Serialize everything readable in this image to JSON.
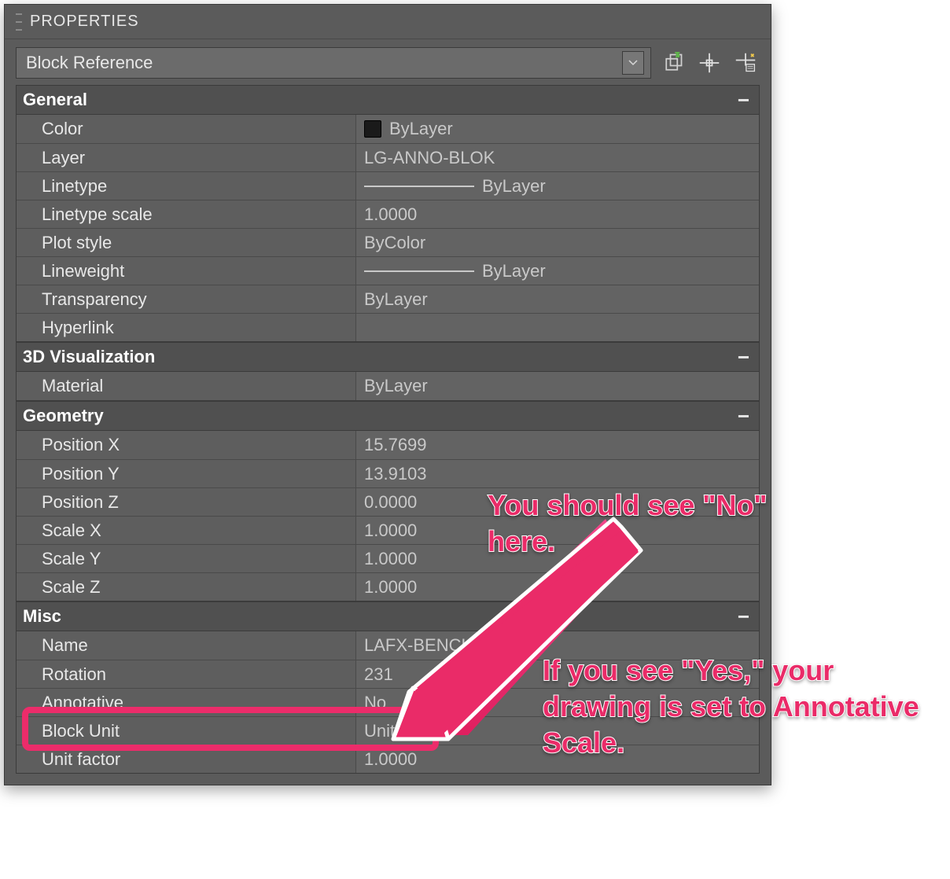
{
  "panel": {
    "title": "PROPERTIES",
    "dropdown_value": "Block Reference",
    "icons": [
      "toggle-pim-icon",
      "crosshair-icon",
      "quick-select-icon"
    ]
  },
  "sections": {
    "general": {
      "title": "General",
      "rows": {
        "color": {
          "label": "Color",
          "value": "ByLayer"
        },
        "layer": {
          "label": "Layer",
          "value": "LG-ANNO-BLOK"
        },
        "linetype": {
          "label": "Linetype",
          "value": "ByLayer"
        },
        "linetype_scale": {
          "label": "Linetype scale",
          "value": "1.0000"
        },
        "plot_style": {
          "label": "Plot style",
          "value": "ByColor"
        },
        "lineweight": {
          "label": "Lineweight",
          "value": "ByLayer"
        },
        "transparency": {
          "label": "Transparency",
          "value": "ByLayer"
        },
        "hyperlink": {
          "label": "Hyperlink",
          "value": ""
        }
      }
    },
    "viz3d": {
      "title": "3D Visualization",
      "rows": {
        "material": {
          "label": "Material",
          "value": "ByLayer"
        }
      }
    },
    "geometry": {
      "title": "Geometry",
      "rows": {
        "pos_x": {
          "label": "Position X",
          "value": "15.7699"
        },
        "pos_y": {
          "label": "Position Y",
          "value": "13.9103"
        },
        "pos_z": {
          "label": "Position Z",
          "value": "0.0000"
        },
        "scale_x": {
          "label": "Scale X",
          "value": "1.0000"
        },
        "scale_y": {
          "label": "Scale Y",
          "value": "1.0000"
        },
        "scale_z": {
          "label": "Scale Z",
          "value": "1.0000"
        }
      }
    },
    "misc": {
      "title": "Misc",
      "rows": {
        "name": {
          "label": "Name",
          "value": "LAFX-BENCH      10"
        },
        "rotation": {
          "label": "Rotation",
          "value": "231"
        },
        "annotative": {
          "label": "Annotative",
          "value": "No"
        },
        "block_unit": {
          "label": "Block Unit",
          "value": "Unitless"
        },
        "unit_factor": {
          "label": "Unit factor",
          "value": "1.0000"
        }
      }
    }
  },
  "annotations": {
    "top": "You should see \"No\" here.",
    "bottom": "If you see \"Yes,\" your drawing is set to Annotative Scale."
  }
}
